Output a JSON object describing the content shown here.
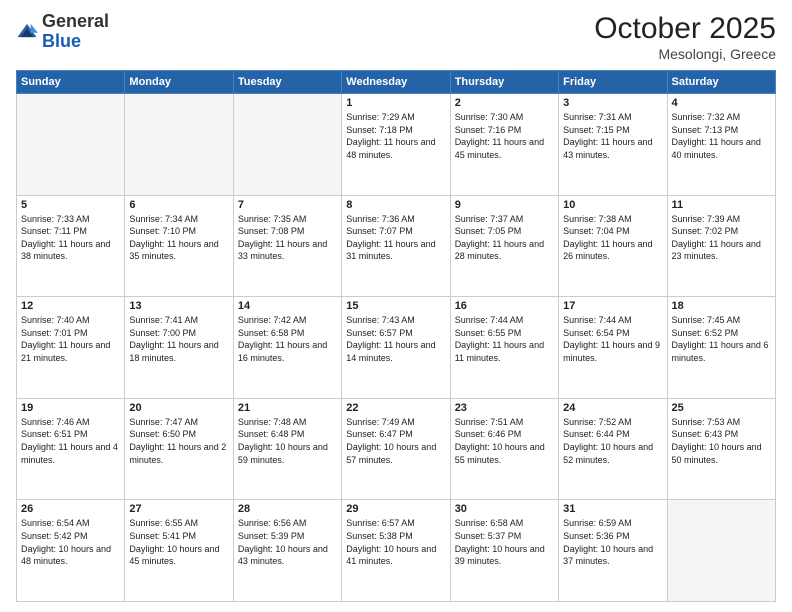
{
  "logo": {
    "general": "General",
    "blue": "Blue"
  },
  "title": "October 2025",
  "location": "Mesolongi, Greece",
  "days_of_week": [
    "Sunday",
    "Monday",
    "Tuesday",
    "Wednesday",
    "Thursday",
    "Friday",
    "Saturday"
  ],
  "weeks": [
    [
      {
        "num": "",
        "text": ""
      },
      {
        "num": "",
        "text": ""
      },
      {
        "num": "",
        "text": ""
      },
      {
        "num": "1",
        "text": "Sunrise: 7:29 AM\nSunset: 7:18 PM\nDaylight: 11 hours and 48 minutes."
      },
      {
        "num": "2",
        "text": "Sunrise: 7:30 AM\nSunset: 7:16 PM\nDaylight: 11 hours and 45 minutes."
      },
      {
        "num": "3",
        "text": "Sunrise: 7:31 AM\nSunset: 7:15 PM\nDaylight: 11 hours and 43 minutes."
      },
      {
        "num": "4",
        "text": "Sunrise: 7:32 AM\nSunset: 7:13 PM\nDaylight: 11 hours and 40 minutes."
      }
    ],
    [
      {
        "num": "5",
        "text": "Sunrise: 7:33 AM\nSunset: 7:11 PM\nDaylight: 11 hours and 38 minutes."
      },
      {
        "num": "6",
        "text": "Sunrise: 7:34 AM\nSunset: 7:10 PM\nDaylight: 11 hours and 35 minutes."
      },
      {
        "num": "7",
        "text": "Sunrise: 7:35 AM\nSunset: 7:08 PM\nDaylight: 11 hours and 33 minutes."
      },
      {
        "num": "8",
        "text": "Sunrise: 7:36 AM\nSunset: 7:07 PM\nDaylight: 11 hours and 31 minutes."
      },
      {
        "num": "9",
        "text": "Sunrise: 7:37 AM\nSunset: 7:05 PM\nDaylight: 11 hours and 28 minutes."
      },
      {
        "num": "10",
        "text": "Sunrise: 7:38 AM\nSunset: 7:04 PM\nDaylight: 11 hours and 26 minutes."
      },
      {
        "num": "11",
        "text": "Sunrise: 7:39 AM\nSunset: 7:02 PM\nDaylight: 11 hours and 23 minutes."
      }
    ],
    [
      {
        "num": "12",
        "text": "Sunrise: 7:40 AM\nSunset: 7:01 PM\nDaylight: 11 hours and 21 minutes."
      },
      {
        "num": "13",
        "text": "Sunrise: 7:41 AM\nSunset: 7:00 PM\nDaylight: 11 hours and 18 minutes."
      },
      {
        "num": "14",
        "text": "Sunrise: 7:42 AM\nSunset: 6:58 PM\nDaylight: 11 hours and 16 minutes."
      },
      {
        "num": "15",
        "text": "Sunrise: 7:43 AM\nSunset: 6:57 PM\nDaylight: 11 hours and 14 minutes."
      },
      {
        "num": "16",
        "text": "Sunrise: 7:44 AM\nSunset: 6:55 PM\nDaylight: 11 hours and 11 minutes."
      },
      {
        "num": "17",
        "text": "Sunrise: 7:44 AM\nSunset: 6:54 PM\nDaylight: 11 hours and 9 minutes."
      },
      {
        "num": "18",
        "text": "Sunrise: 7:45 AM\nSunset: 6:52 PM\nDaylight: 11 hours and 6 minutes."
      }
    ],
    [
      {
        "num": "19",
        "text": "Sunrise: 7:46 AM\nSunset: 6:51 PM\nDaylight: 11 hours and 4 minutes."
      },
      {
        "num": "20",
        "text": "Sunrise: 7:47 AM\nSunset: 6:50 PM\nDaylight: 11 hours and 2 minutes."
      },
      {
        "num": "21",
        "text": "Sunrise: 7:48 AM\nSunset: 6:48 PM\nDaylight: 10 hours and 59 minutes."
      },
      {
        "num": "22",
        "text": "Sunrise: 7:49 AM\nSunset: 6:47 PM\nDaylight: 10 hours and 57 minutes."
      },
      {
        "num": "23",
        "text": "Sunrise: 7:51 AM\nSunset: 6:46 PM\nDaylight: 10 hours and 55 minutes."
      },
      {
        "num": "24",
        "text": "Sunrise: 7:52 AM\nSunset: 6:44 PM\nDaylight: 10 hours and 52 minutes."
      },
      {
        "num": "25",
        "text": "Sunrise: 7:53 AM\nSunset: 6:43 PM\nDaylight: 10 hours and 50 minutes."
      }
    ],
    [
      {
        "num": "26",
        "text": "Sunrise: 6:54 AM\nSunset: 5:42 PM\nDaylight: 10 hours and 48 minutes."
      },
      {
        "num": "27",
        "text": "Sunrise: 6:55 AM\nSunset: 5:41 PM\nDaylight: 10 hours and 45 minutes."
      },
      {
        "num": "28",
        "text": "Sunrise: 6:56 AM\nSunset: 5:39 PM\nDaylight: 10 hours and 43 minutes."
      },
      {
        "num": "29",
        "text": "Sunrise: 6:57 AM\nSunset: 5:38 PM\nDaylight: 10 hours and 41 minutes."
      },
      {
        "num": "30",
        "text": "Sunrise: 6:58 AM\nSunset: 5:37 PM\nDaylight: 10 hours and 39 minutes."
      },
      {
        "num": "31",
        "text": "Sunrise: 6:59 AM\nSunset: 5:36 PM\nDaylight: 10 hours and 37 minutes."
      },
      {
        "num": "",
        "text": ""
      }
    ]
  ]
}
